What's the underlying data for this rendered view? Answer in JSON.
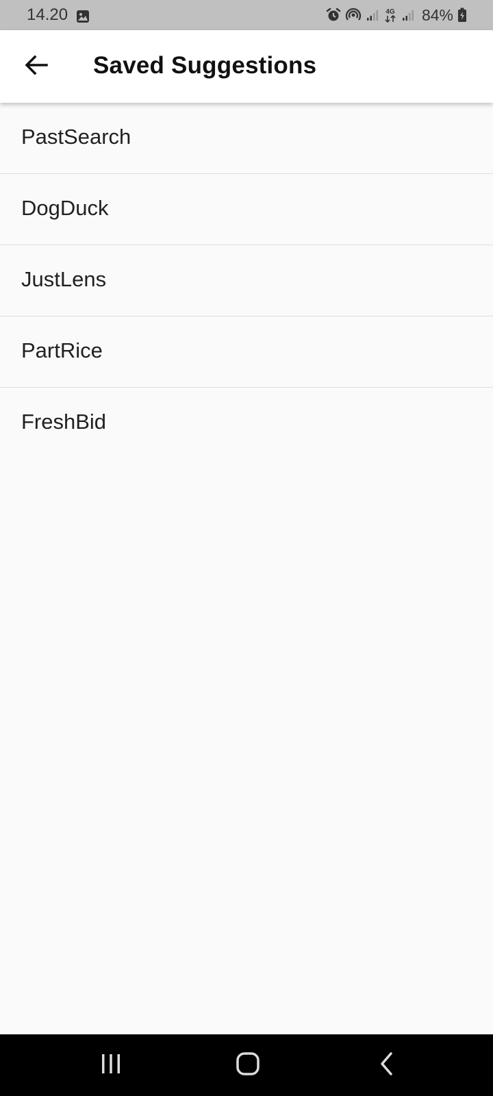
{
  "status_bar": {
    "time": "14.20",
    "battery": "84%",
    "network": "4G",
    "icons": [
      "image-icon",
      "alarm-icon",
      "hotspot-icon",
      "signal-icon",
      "data-4g-icon",
      "signal-icon",
      "battery-charging-icon"
    ]
  },
  "app_bar": {
    "title": "Saved Suggestions",
    "back_icon": "arrow-back-icon"
  },
  "saved_list": {
    "items": [
      {
        "label": "PastSearch"
      },
      {
        "label": "DogDuck"
      },
      {
        "label": "JustLens"
      },
      {
        "label": "PartRice"
      },
      {
        "label": "FreshBid"
      }
    ]
  },
  "nav_bar": {
    "icons": [
      "recent-apps-icon",
      "home-icon",
      "back-icon"
    ]
  },
  "colors": {
    "status_bar_bg": "#c0c0c0",
    "app_bar_bg": "#ffffff",
    "page_bg": "#fafafa",
    "divider": "#dedede",
    "nav_bar_bg": "#000000"
  }
}
